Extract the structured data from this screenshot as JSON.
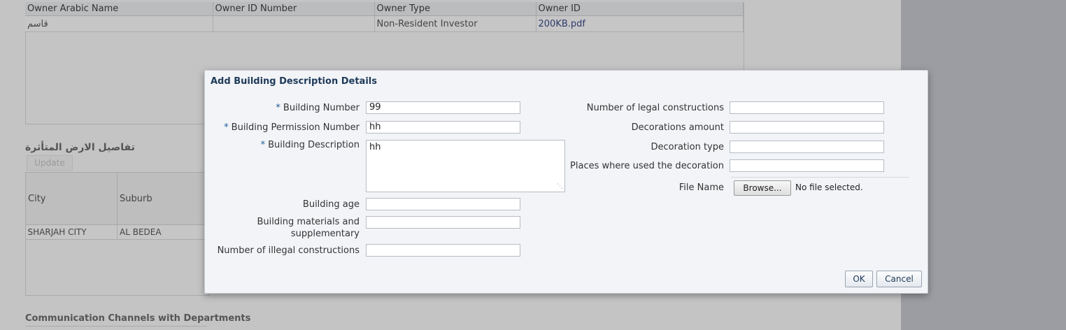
{
  "owners": {
    "columns": [
      "Owner Arabic Name",
      "Owner ID Number",
      "Owner Type",
      "Owner ID"
    ],
    "row": {
      "arabic_name": "قاسم",
      "id_number": "",
      "owner_type": "Non-Resident Investor",
      "owner_id_link": "200KB.pdf"
    }
  },
  "land_section": {
    "title": "تفاصيل الارض المتأثرة",
    "update_label": "Update",
    "columns": [
      "City",
      "Suburb"
    ],
    "row": [
      "SHARJAH CITY",
      "AL BEDEA"
    ]
  },
  "communication_section": {
    "title": "Communication Channels with Departments"
  },
  "dialog": {
    "title": "Add Building Description Details",
    "required_marker": "*",
    "left": {
      "building_number": {
        "label": "Building Number",
        "value": "99"
      },
      "building_permission_number": {
        "label": "Building Permission Number",
        "value": "hh"
      },
      "building_description": {
        "label": "Building Description",
        "value": "hh"
      },
      "building_age": {
        "label": "Building age",
        "value": ""
      },
      "building_materials": {
        "label_line1": "Building materials and",
        "label_line2": "supplementary",
        "value": ""
      },
      "illegal_constructions": {
        "label": "Number of illegal constructions",
        "value": ""
      }
    },
    "right": {
      "legal_constructions": {
        "label": "Number of legal constructions",
        "value": ""
      },
      "decorations_amount": {
        "label": "Decorations amount",
        "value": ""
      },
      "decoration_type": {
        "label": "Decoration type",
        "value": ""
      },
      "decoration_places": {
        "label": "Places where used the decoration",
        "value": ""
      },
      "file_name": {
        "label": "File Name",
        "browse_label": "Browse...",
        "status": "No file selected."
      }
    },
    "ok_label": "OK",
    "cancel_label": "Cancel"
  },
  "colors": {
    "dialog_title": "#1f3a5a",
    "required_marker": "#1f5a9a",
    "link": "#2d3a6b"
  }
}
